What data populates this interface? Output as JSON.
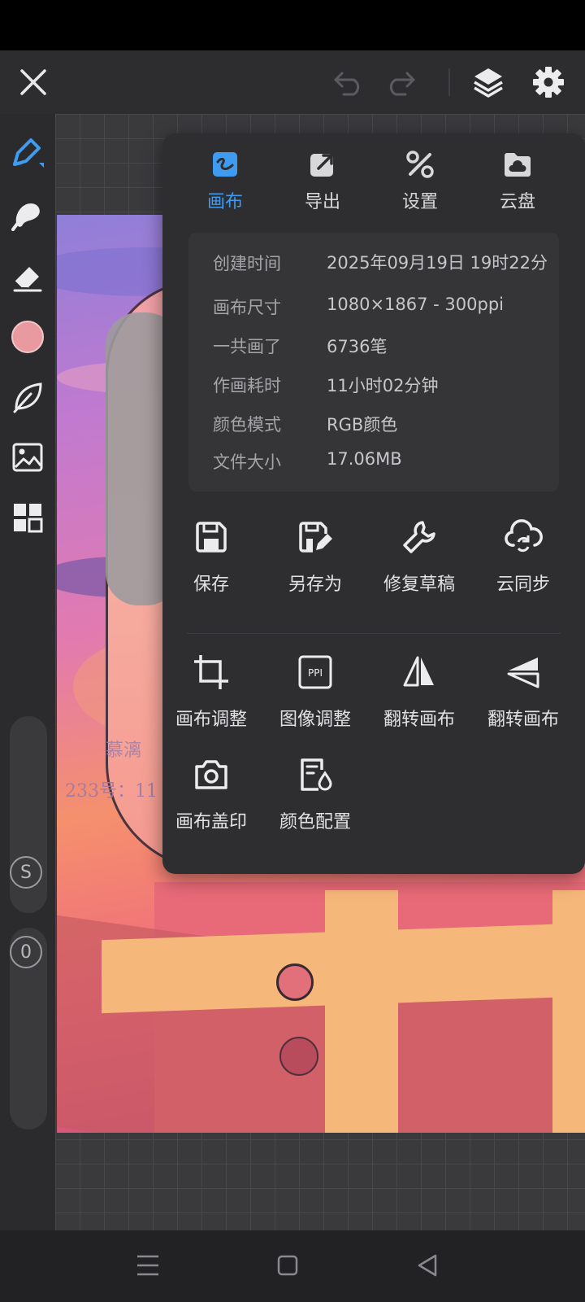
{
  "colors": {
    "accent": "#3f9bf0",
    "panel_bg": "#2e2e31",
    "info_bg": "#353538",
    "brush_color": "#e89aa0"
  },
  "topbar": {
    "close_icon": "close-icon",
    "undo_icon": "undo-icon",
    "redo_icon": "redo-icon",
    "layers_icon": "layers-icon",
    "settings_icon": "gear-icon"
  },
  "left_tools": [
    {
      "name": "brush-tool",
      "icon": "pen-icon",
      "active": true
    },
    {
      "name": "smudge-tool",
      "icon": "smudge-icon"
    },
    {
      "name": "eraser-tool",
      "icon": "eraser-icon"
    },
    {
      "name": "color-tool",
      "icon": "color-swatch"
    },
    {
      "name": "leaf-tool",
      "icon": "leaf-icon"
    },
    {
      "name": "image-tool",
      "icon": "image-icon"
    },
    {
      "name": "grid-tool",
      "icon": "grid-icon"
    }
  ],
  "sliders": {
    "size_knob": "S",
    "opacity_knob": "0"
  },
  "artwork": {
    "sig_line1": "慕漓",
    "sig_line2": "233号：11"
  },
  "panel": {
    "tabs": [
      {
        "label": "画布",
        "icon": "canvas-icon",
        "active": true
      },
      {
        "label": "导出",
        "icon": "export-icon"
      },
      {
        "label": "设置",
        "icon": "tools-icon"
      },
      {
        "label": "云盘",
        "icon": "cloud-folder-icon"
      }
    ],
    "info": [
      {
        "key": "创建时间",
        "value": "2025年09月19日 19时22分"
      },
      {
        "key": "画布尺寸",
        "value": "1080×1867 - 300ppi"
      },
      {
        "key": "一共画了",
        "value": "6736笔"
      },
      {
        "key": "作画耗时",
        "value": "11小时02分钟"
      },
      {
        "key": "颜色模式",
        "value": "RGB颜色"
      },
      {
        "key": "文件大小",
        "value": "17.06MB"
      }
    ],
    "actions_row1": [
      {
        "label": "保存",
        "icon": "save-icon"
      },
      {
        "label": "另存为",
        "icon": "save-as-icon"
      },
      {
        "label": "修复草稿",
        "icon": "wrench-icon"
      },
      {
        "label": "云同步",
        "icon": "cloud-sync-icon"
      }
    ],
    "actions_row2": [
      {
        "label": "画布调整",
        "icon": "crop-icon"
      },
      {
        "label": "图像调整",
        "icon": "ppi-icon",
        "icon_text": "PPI"
      },
      {
        "label": "翻转画布",
        "icon": "flip-horizontal-icon"
      },
      {
        "label": "翻转画布",
        "icon": "flip-vertical-icon"
      }
    ],
    "actions_row3": [
      {
        "label": "画布盖印",
        "icon": "camera-icon"
      },
      {
        "label": "颜色配置",
        "icon": "color-profile-icon"
      }
    ]
  },
  "navbar": {
    "menu_icon": "menu-icon",
    "home_icon": "home-icon",
    "back_icon": "back-icon"
  }
}
